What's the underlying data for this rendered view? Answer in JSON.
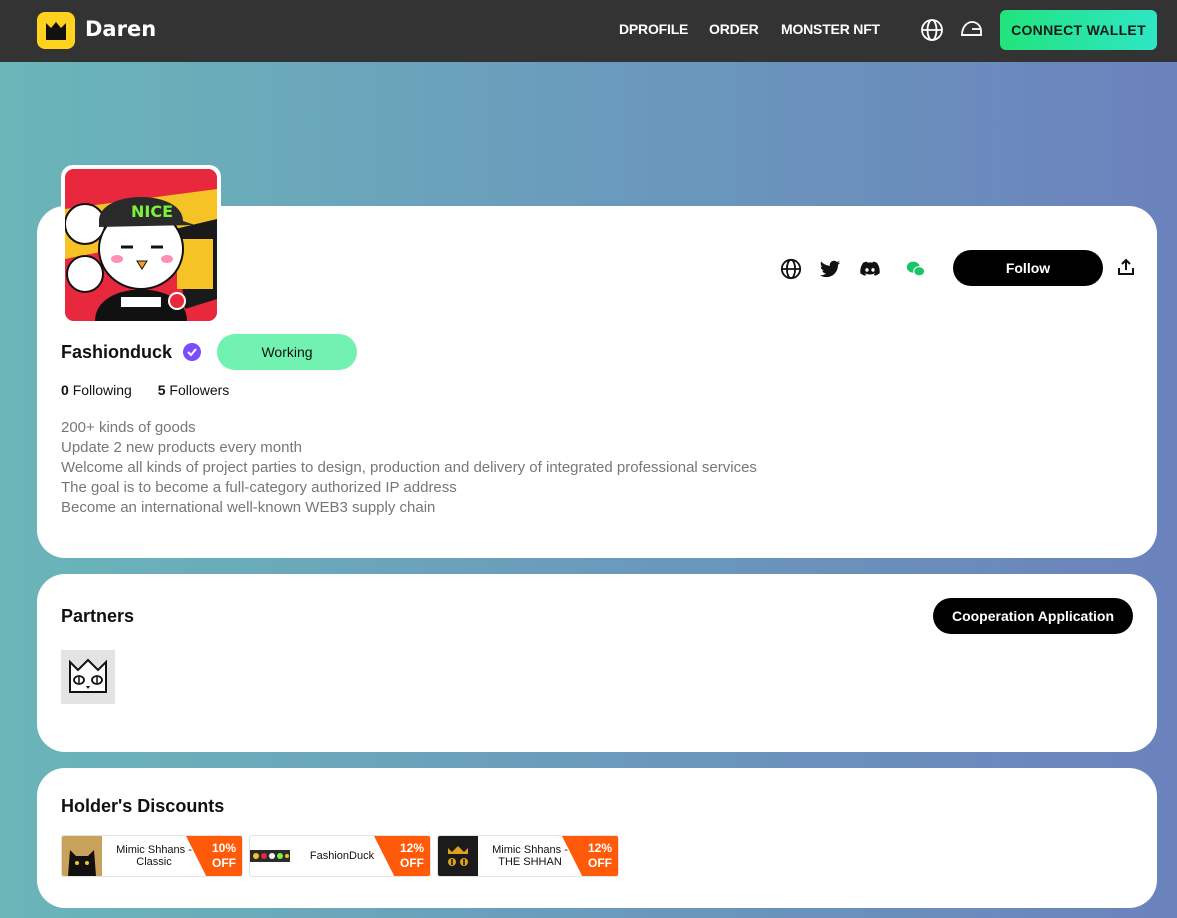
{
  "header": {
    "brand": "Daren",
    "nav": [
      "DPROFILE",
      "ORDER",
      "MONSTER NFT"
    ],
    "connect_label": "CONNECT WALLET"
  },
  "profile": {
    "name": "Fashionduck",
    "status": "Working",
    "following_count": "0",
    "following_label": "Following",
    "followers_count": "5",
    "followers_label": "Followers",
    "bio": [
      "200+ kinds of goods",
      "Update 2 new products every month",
      "Welcome all kinds of project parties to design, production and delivery of integrated professional services",
      "The goal is to become a full-category authorized IP address",
      "Become an international well-known WEB3 supply chain"
    ],
    "follow_label": "Follow",
    "avatar_text": "NICE"
  },
  "partners": {
    "title": "Partners",
    "cta": "Cooperation Application"
  },
  "discounts": {
    "title": "Holder's Discounts",
    "coupons": [
      {
        "name": "Mimic Shhans - Classic",
        "pct": "10%",
        "off": "OFF"
      },
      {
        "name": "FashionDuck",
        "pct": "12%",
        "off": "OFF"
      },
      {
        "name": "Mimic Shhans - THE SHHAN",
        "pct": "12%",
        "off": "OFF"
      }
    ]
  },
  "colors": {
    "accent_green": "#22e37c",
    "status_green": "#72f2b0",
    "verified_purple": "#7b4cff",
    "badge_orange": "#ff5a0a",
    "wechat_green": "#18c567"
  }
}
